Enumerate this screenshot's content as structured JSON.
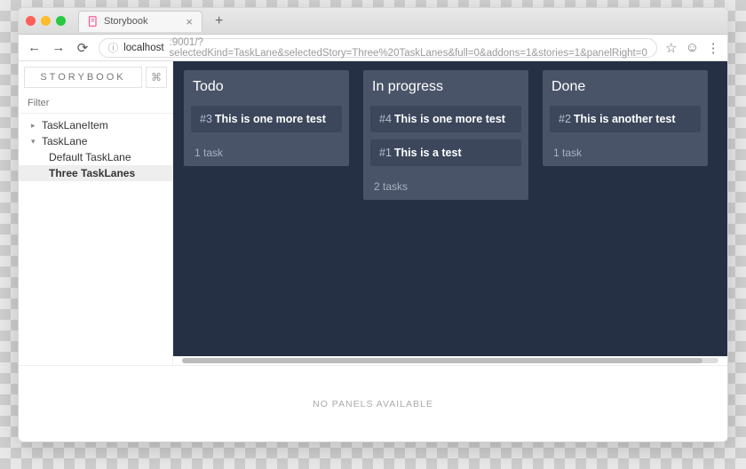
{
  "browser": {
    "tab_title": "Storybook",
    "url_host": "localhost",
    "url_rest": ":9001/?selectedKind=TaskLane&selectedStory=Three%20TaskLanes&full=0&addons=1&stories=1&panelRight=0"
  },
  "sidebar": {
    "logo": "STORYBOOK",
    "shortcut_glyph": "⌘",
    "filter_placeholder": "Filter",
    "tree": {
      "group1": {
        "label": "TaskLaneItem",
        "expanded": false
      },
      "group2": {
        "label": "TaskLane",
        "expanded": true,
        "items": [
          {
            "label": "Default TaskLane",
            "selected": false
          },
          {
            "label": "Three TaskLanes",
            "selected": true
          }
        ]
      }
    }
  },
  "lanes": [
    {
      "title": "Todo",
      "cards": [
        {
          "id": "#3",
          "title": "This is one more test"
        }
      ],
      "count_label": "1 task"
    },
    {
      "title": "In progress",
      "cards": [
        {
          "id": "#4",
          "title": "This is one more test"
        },
        {
          "id": "#1",
          "title": "This is a test"
        }
      ],
      "count_label": "2 tasks"
    },
    {
      "title": "Done",
      "cards": [
        {
          "id": "#2",
          "title": "This is another test"
        }
      ],
      "count_label": "1 task"
    }
  ],
  "addons": {
    "empty_message": "NO PANELS AVAILABLE"
  },
  "icons": {
    "new_tab": "+",
    "close_tab": "×",
    "back": "←",
    "forward": "→",
    "reload": "⟳",
    "info": "ⓘ",
    "star": "☆",
    "user": "☺",
    "menu": "⋮"
  }
}
